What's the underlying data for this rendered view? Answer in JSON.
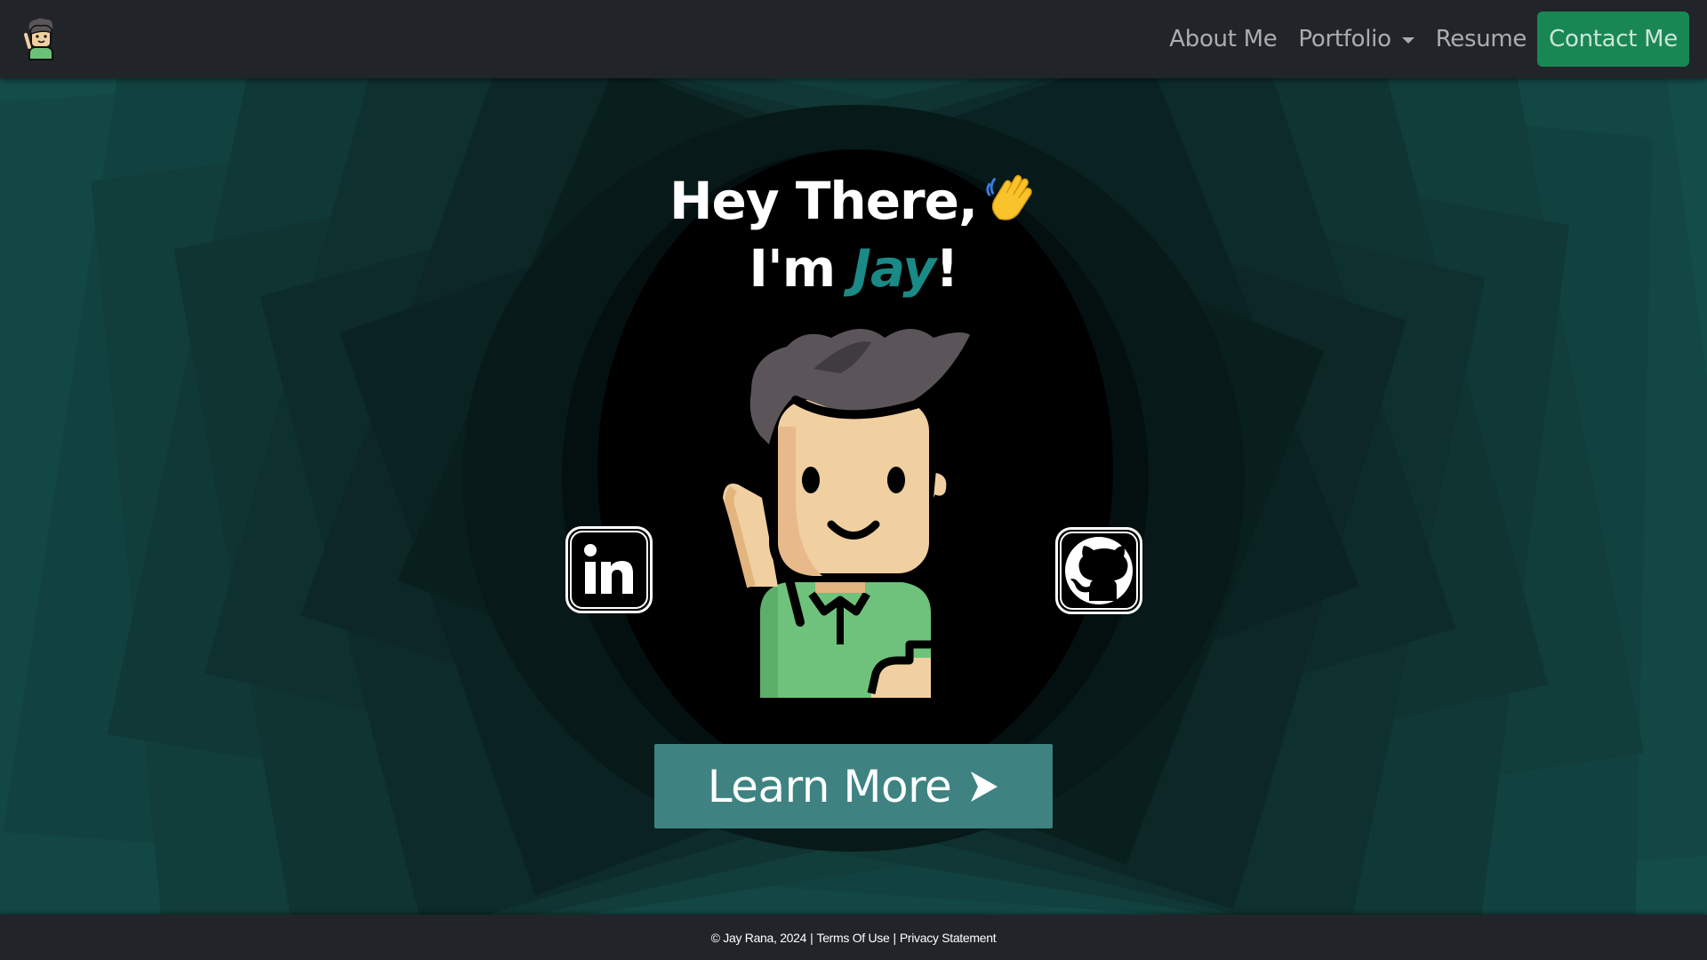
{
  "nav": {
    "brand_icon": "avatar-logo-icon",
    "links": [
      {
        "label": "About Me"
      },
      {
        "label": "Portfolio"
      },
      {
        "label": "Resume"
      }
    ],
    "contact_label": "Contact Me",
    "colors": {
      "navbar": "#212529",
      "contact": "#198754"
    }
  },
  "hero": {
    "greeting": "Hey There,",
    "wave_icon": "waving-hand-icon",
    "intro_prefix": "I'm ",
    "name": "Jay",
    "intro_suffix": "!",
    "avatar_icon": "waving-man-avatar-icon",
    "social": {
      "linkedin_icon": "linkedin-icon",
      "github_icon": "github-icon"
    },
    "cta_label": "Learn More",
    "cta_icon": "arrow-right-icon",
    "colors": {
      "accent": "#1a8a86",
      "cta": "#3e8381"
    }
  },
  "footer": {
    "copyright": "© Jay Rana, 2024",
    "separator": "|",
    "terms": "Terms Of Use",
    "privacy": "Privacy Statement"
  }
}
